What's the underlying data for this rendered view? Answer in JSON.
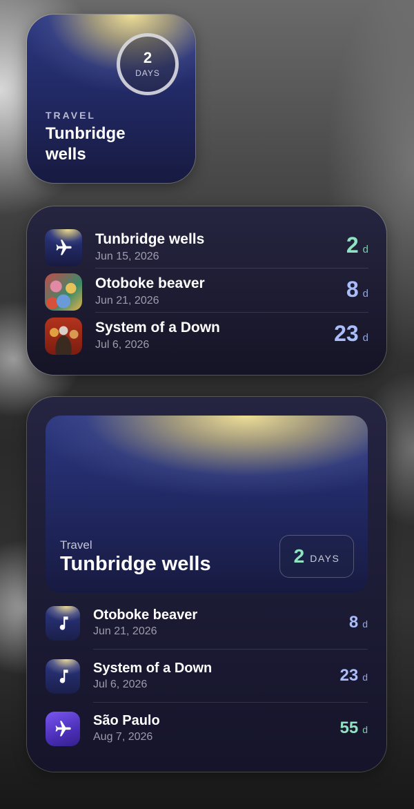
{
  "small_widget": {
    "count": "2",
    "unit": "DAYS",
    "category": "TRAVEL",
    "title_line1": "Tunbridge",
    "title_line2": "wells"
  },
  "medium_widget": {
    "items": [
      {
        "title": "Tunbridge wells",
        "date": "Jun 15, 2026",
        "count": "2",
        "unit": "d",
        "icon": "airplane-icon",
        "color": "#8fe3c0"
      },
      {
        "title": "Otoboke beaver",
        "date": "Jun 21, 2026",
        "count": "8",
        "unit": "d",
        "icon": "band-photo",
        "color": "#a9bdfb"
      },
      {
        "title": "System of a Down",
        "date": "Jul 6, 2026",
        "count": "23",
        "unit": "d",
        "icon": "band-photo",
        "color": "#a9bdfb"
      }
    ]
  },
  "large_widget": {
    "hero": {
      "category": "Travel",
      "title": "Tunbridge wells",
      "count": "2",
      "unit": "DAYS"
    },
    "items": [
      {
        "title": "Otoboke beaver",
        "date": "Jun 21, 2026",
        "count": "8",
        "unit": "d",
        "icon": "music-note-icon",
        "color": "#a9bdfb"
      },
      {
        "title": "System of a Down",
        "date": "Jul 6, 2026",
        "count": "23",
        "unit": "d",
        "icon": "music-note-icon",
        "color": "#a9bdfb"
      },
      {
        "title": "São Paulo",
        "date": "Aug 7, 2026",
        "count": "55",
        "unit": "d",
        "icon": "airplane-icon",
        "color": "#8fe3c0"
      }
    ]
  },
  "colors": {
    "accent_green": "#8fe3c0",
    "accent_blue": "#a9bdfb",
    "widget_bg": "#1b1a30"
  }
}
